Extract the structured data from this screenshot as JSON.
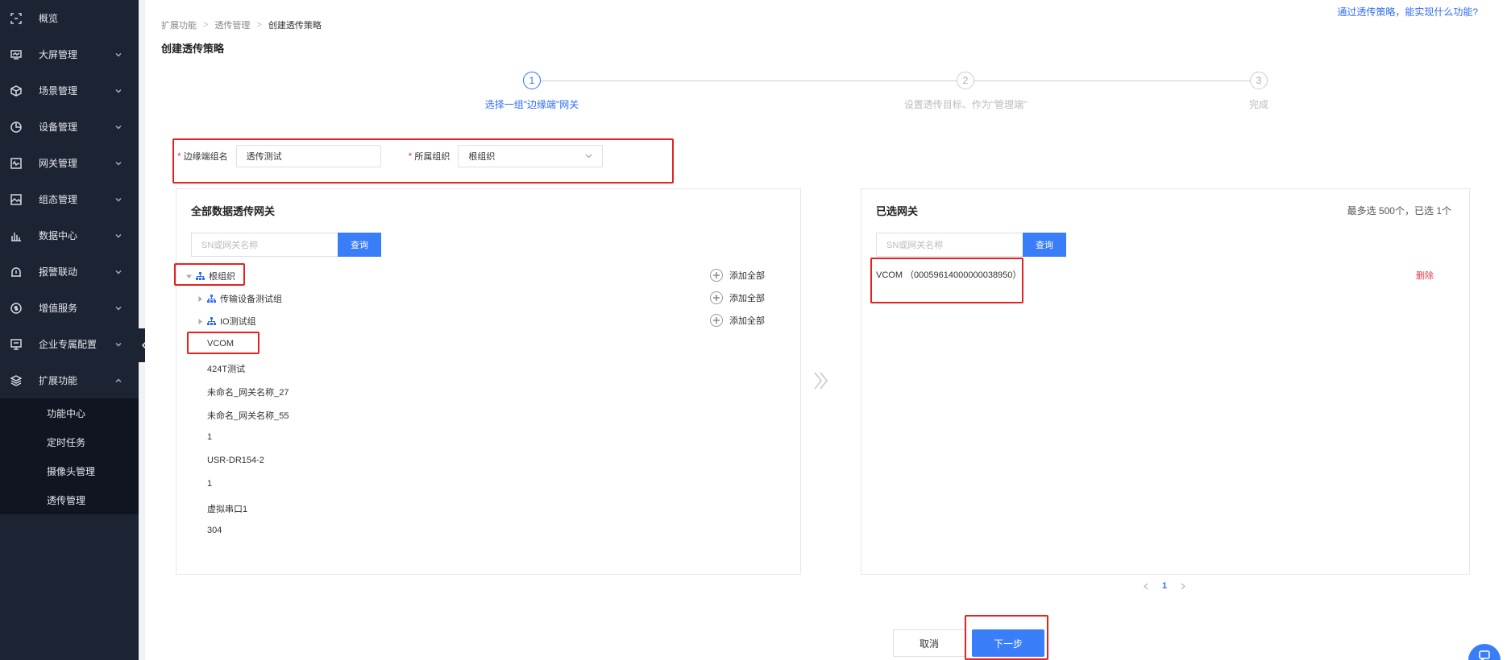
{
  "sidebar": {
    "items": [
      {
        "label": "概览",
        "icon": "scan-icon"
      },
      {
        "label": "大屏管理",
        "icon": "monitor-icon"
      },
      {
        "label": "场景管理",
        "icon": "cube-icon"
      },
      {
        "label": "设备管理",
        "icon": "pie-icon"
      },
      {
        "label": "网关管理",
        "icon": "gateway-icon"
      },
      {
        "label": "组态管理",
        "icon": "image-icon"
      },
      {
        "label": "数据中心",
        "icon": "bar-chart-icon"
      },
      {
        "label": "报警联动",
        "icon": "alarm-icon"
      },
      {
        "label": "增值服务",
        "icon": "dollar-icon"
      },
      {
        "label": "企业专属配置",
        "icon": "config-icon"
      },
      {
        "label": "扩展功能",
        "icon": "layers-icon"
      }
    ],
    "submenu": [
      {
        "label": "功能中心"
      },
      {
        "label": "定时任务"
      },
      {
        "label": "摄像头管理"
      },
      {
        "label": "透传管理"
      }
    ]
  },
  "breadcrumb": {
    "item1": "扩展功能",
    "item2": "透传管理",
    "item3": "创建透传策略"
  },
  "page_title": "创建透传策略",
  "help_link": "通过透传策略，能实现什么功能?",
  "steps": [
    {
      "num": "1",
      "label": "选择一组\"边缘端\"网关",
      "active": true
    },
    {
      "num": "2",
      "label": "设置透传目标、作为\"管理端\"",
      "active": false
    },
    {
      "num": "3",
      "label": "完成",
      "active": false
    }
  ],
  "form": {
    "edge_label": "边缘端组名",
    "edge_value": "透传测试",
    "org_label": "所属组织",
    "org_value": "根组织"
  },
  "left_panel": {
    "title": "全部数据透传网关",
    "search_placeholder": "SN或网关名称",
    "search_button": "查询",
    "root": "根组织",
    "add_all": "添加全部",
    "groups": [
      "传输设备测试组",
      "IO测试组"
    ],
    "gateways": [
      "VCOM",
      "424T测试",
      "未命名_网关名称_27",
      "未命名_网关名称_55",
      "1",
      "USR-DR154-2",
      "1",
      "虚拟串口1",
      "304"
    ]
  },
  "right_panel": {
    "title": "已选网关",
    "count_text": "最多选 500个，已选 1个",
    "search_placeholder": "SN或网关名称",
    "search_button": "查询",
    "selected": "VCOM （00059614000000038950）",
    "delete": "删除"
  },
  "pagination": {
    "current": "1"
  },
  "buttons": {
    "cancel": "取消",
    "next": "下一步"
  }
}
